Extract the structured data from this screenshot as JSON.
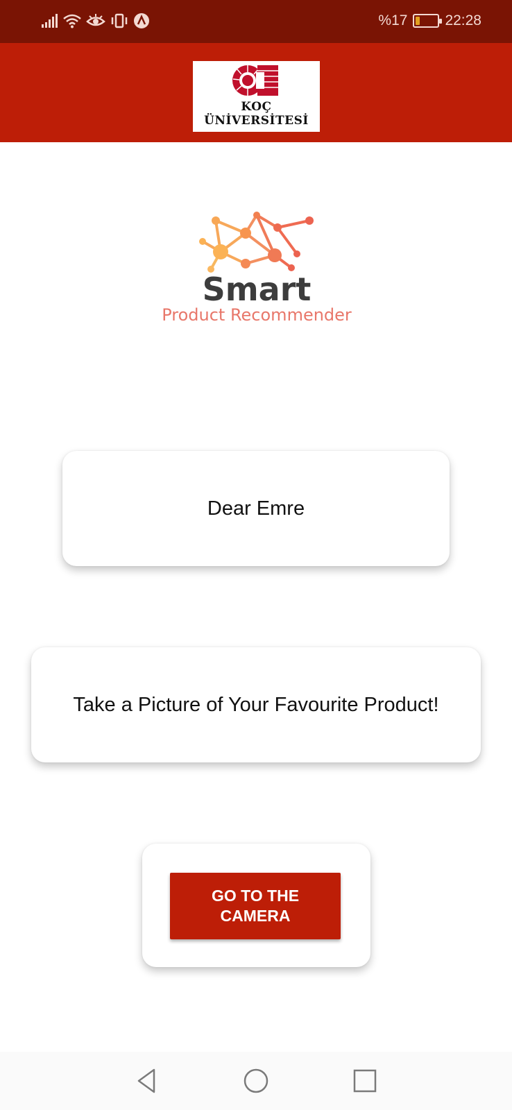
{
  "status_bar": {
    "battery_text": "%17",
    "time": "22:28",
    "battery_level": 0.17,
    "icons": [
      "signal-icon",
      "wifi-icon",
      "eye-icon",
      "vibrate-icon",
      "app-notification-icon",
      "battery-icon"
    ]
  },
  "header": {
    "logo_line1": "KOÇ",
    "logo_line2": "ÜNİVERSİTESİ",
    "accent_color": "#bd1e07"
  },
  "app_logo": {
    "title": "Smart",
    "subtitle": "Product Recommender"
  },
  "greeting": {
    "text": "Dear Emre"
  },
  "prompt": {
    "text": "Take a Picture of Your Favourite Product!"
  },
  "camera_button": {
    "label": "GO TO THE CAMERA"
  },
  "nav_bar": {
    "icons": [
      "back-icon",
      "home-icon",
      "recents-icon"
    ]
  }
}
